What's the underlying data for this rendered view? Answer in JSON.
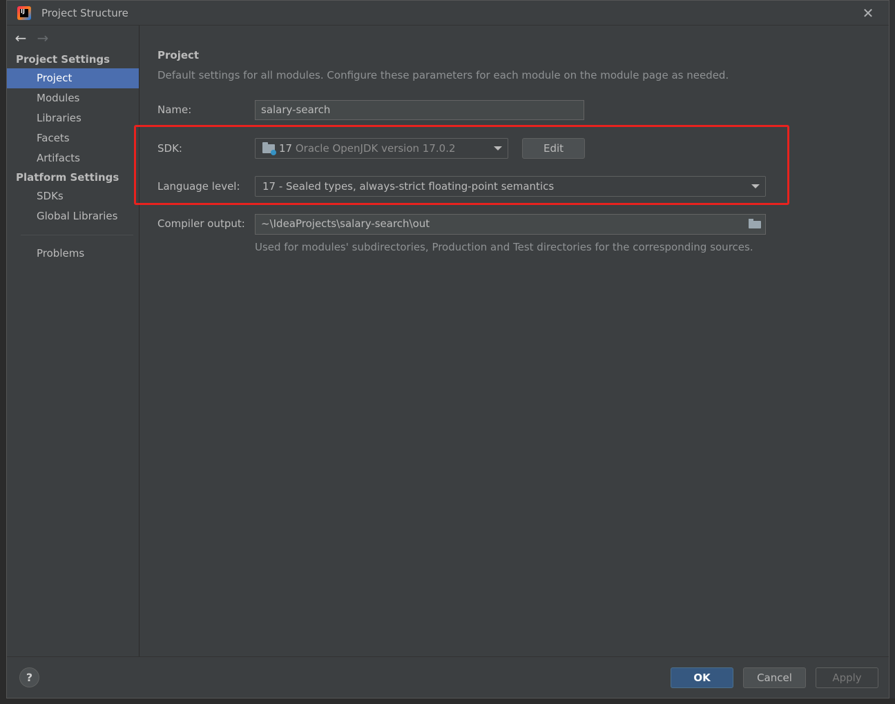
{
  "window": {
    "title": "Project Structure"
  },
  "sidebar": {
    "project_settings_header": "Project Settings",
    "project_settings_items": [
      {
        "label": "Project",
        "selected": true
      },
      {
        "label": "Modules"
      },
      {
        "label": "Libraries"
      },
      {
        "label": "Facets"
      },
      {
        "label": "Artifacts"
      }
    ],
    "platform_settings_header": "Platform Settings",
    "platform_settings_items": [
      {
        "label": "SDKs"
      },
      {
        "label": "Global Libraries"
      }
    ],
    "problems_label": "Problems"
  },
  "content": {
    "title": "Project",
    "description": "Default settings for all modules. Configure these parameters for each module on the module page as needed.",
    "name_label": "Name:",
    "name_value": "salary-search",
    "sdk_label": "SDK:",
    "sdk_version": "17",
    "sdk_name": "Oracle OpenJDK version 17.0.2",
    "edit_button": "Edit",
    "language_level_label": "Language level:",
    "language_level_value": "17 - Sealed types, always-strict floating-point semantics",
    "compiler_output_label": "Compiler output:",
    "compiler_output_value": "~\\IdeaProjects\\salary-search\\out",
    "compiler_output_hint": "Used for modules' subdirectories, Production and Test directories for the corresponding sources."
  },
  "footer": {
    "help": "?",
    "ok": "OK",
    "cancel": "Cancel",
    "apply": "Apply"
  },
  "colors": {
    "selection": "#4b6eaf",
    "highlight": "#e8221e",
    "primary_button": "#365880"
  }
}
